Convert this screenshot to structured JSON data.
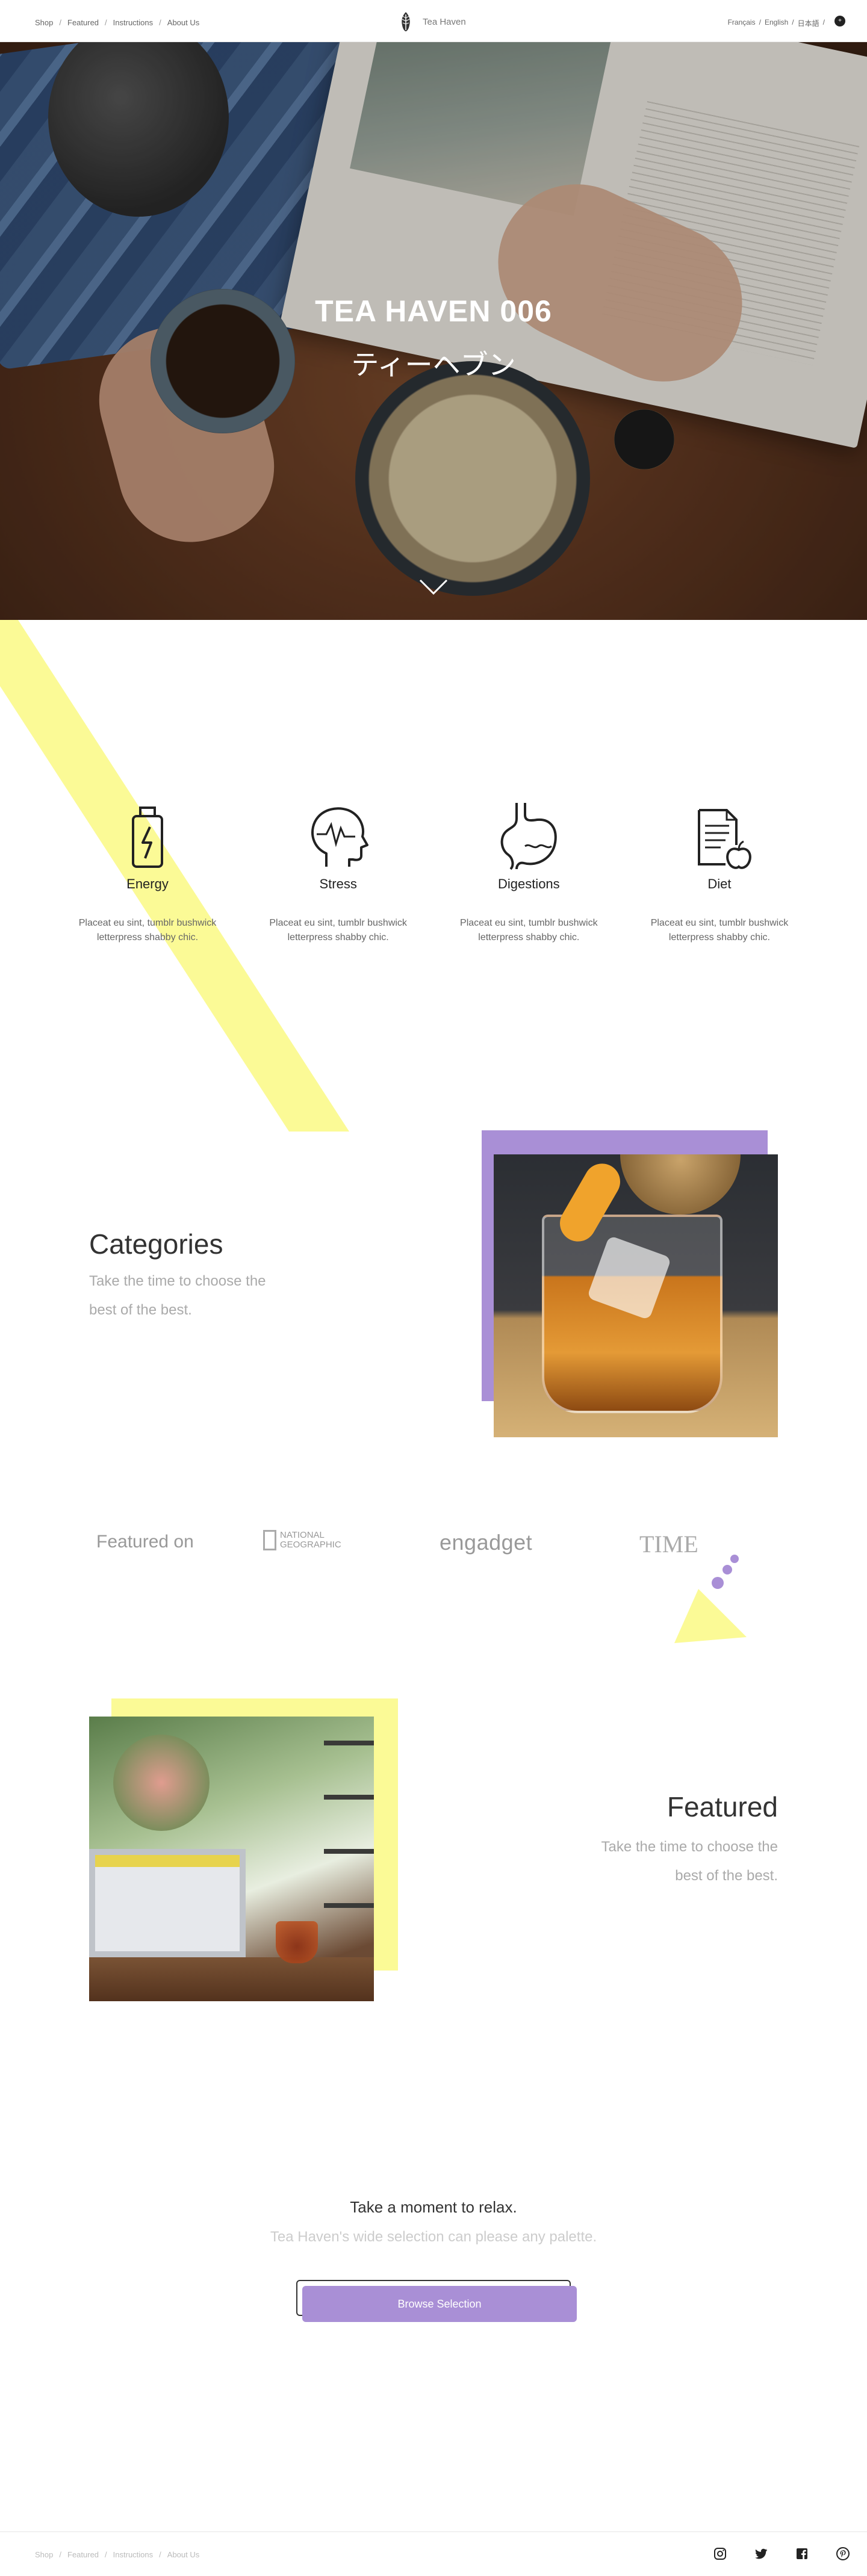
{
  "nav": {
    "links": [
      "Shop",
      "Featured",
      "Instructions",
      "About Us"
    ],
    "separator": "/",
    "brand": "Tea Haven",
    "languages": [
      "Français",
      "English",
      "日本語"
    ],
    "lang_trailing_sep": "/",
    "lang_button": "+"
  },
  "hero": {
    "title": "TEA HAVEN 006",
    "subtitle": "ティーヘブン",
    "scroll_icon": "chevron-down-icon"
  },
  "benefits": [
    {
      "icon": "battery-bolt-icon",
      "title": "Energy",
      "text": "Placeat eu sint, tumblr bushwick letterpress shabby chic."
    },
    {
      "icon": "head-pulse-icon",
      "title": "Stress",
      "text": "Placeat eu sint, tumblr bushwick letterpress shabby chic."
    },
    {
      "icon": "stomach-icon",
      "title": "Digestions",
      "text": "Placeat eu sint, tumblr bushwick letterpress shabby chic."
    },
    {
      "icon": "document-apple-icon",
      "title": "Diet",
      "text": "Placeat eu sint, tumblr bushwick letterpress shabby chic."
    }
  ],
  "categories": {
    "title": "Categories",
    "subtitle": "Take the time to choose the best of the best."
  },
  "featured_on": {
    "label": "Featured on",
    "logos": {
      "natgeo_line1": "NATIONAL",
      "natgeo_line2": "GEOGRAPHIC",
      "engadget": "engadget",
      "time": "TIME"
    }
  },
  "featured": {
    "title": "Featured",
    "subtitle": "Take the time to choose the best of the best."
  },
  "cta": {
    "title": "Take a moment to relax.",
    "subtitle": "Tea Haven's wide selection can please any palette.",
    "button": "Browse Selection"
  },
  "footer": {
    "links": [
      "Shop",
      "Featured",
      "Instructions",
      "About Us"
    ],
    "separator": "/",
    "social": [
      "instagram-icon",
      "twitter-icon",
      "facebook-icon",
      "pinterest-icon"
    ]
  },
  "colors": {
    "accent_purple": "#a98fd6",
    "accent_yellow": "#fbfa96",
    "text_dark": "#333333",
    "text_muted": "#aaaaaa"
  }
}
